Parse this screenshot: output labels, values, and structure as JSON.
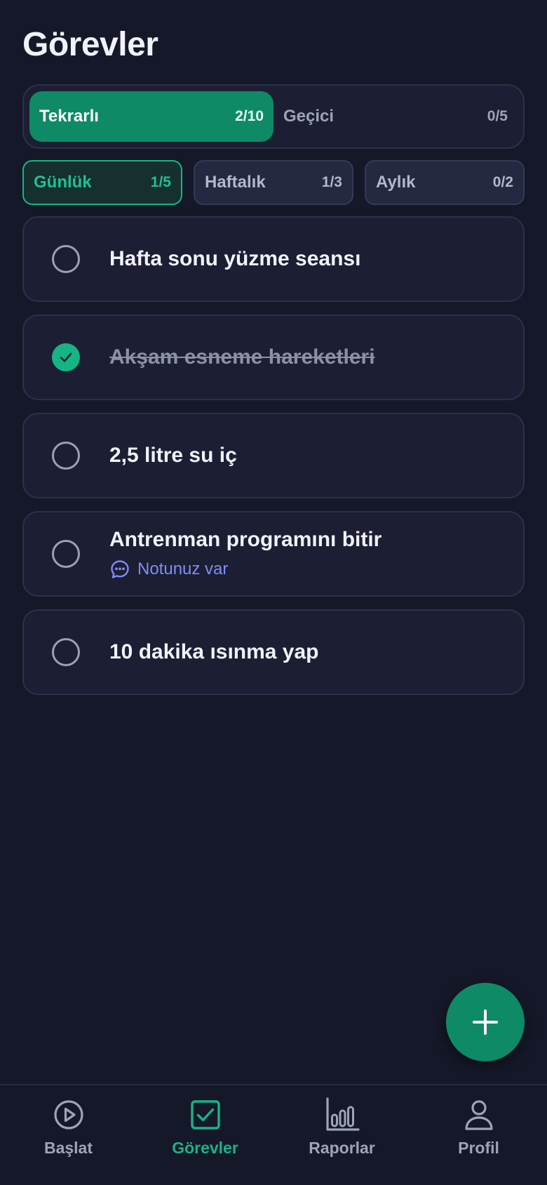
{
  "header": {
    "title": "Görevler"
  },
  "segments": [
    {
      "label": "Tekrarlı",
      "count": "2/10",
      "active": true
    },
    {
      "label": "Geçici",
      "count": "0/5",
      "active": false
    }
  ],
  "periods": [
    {
      "label": "Günlük",
      "count": "1/5",
      "active": true
    },
    {
      "label": "Haftalık",
      "count": "1/3",
      "active": false
    },
    {
      "label": "Aylık",
      "count": "0/2",
      "active": false
    }
  ],
  "tasks": [
    {
      "title": "Hafta sonu yüzme seansı",
      "done": false,
      "note": null
    },
    {
      "title": "Akşam esneme hareketleri",
      "done": true,
      "note": null
    },
    {
      "title": "2,5 litre su iç",
      "done": false,
      "note": null
    },
    {
      "title": "Antrenman programını bitir",
      "done": false,
      "note": "Notunuz var"
    },
    {
      "title": "10 dakika ısınma yap",
      "done": false,
      "note": null
    }
  ],
  "fab": {
    "icon": "plus-icon"
  },
  "nav": [
    {
      "label": "Başlat",
      "icon": "play-circle-icon",
      "active": false
    },
    {
      "label": "Görevler",
      "icon": "checkbox-icon",
      "active": true
    },
    {
      "label": "Raporlar",
      "icon": "bar-chart-icon",
      "active": false
    },
    {
      "label": "Profil",
      "icon": "user-icon",
      "active": false
    }
  ],
  "colors": {
    "background": "#151829",
    "card": "#1C1F33",
    "accent": "#0E8A66",
    "accent_text": "#17B486",
    "note": "#7F8CF5"
  }
}
